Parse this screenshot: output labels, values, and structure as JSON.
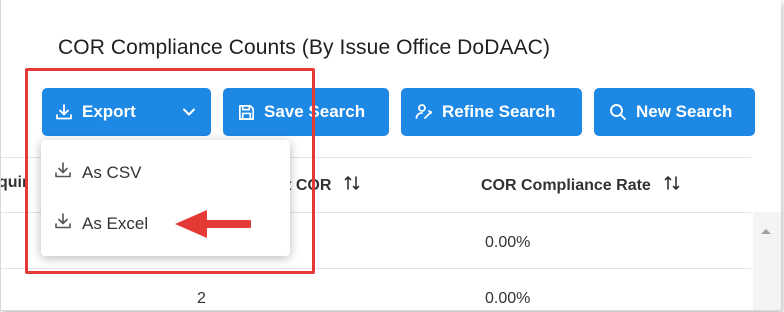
{
  "page": {
    "title": "COR Compliance Counts (By Issue Office DoDAAC)"
  },
  "toolbar": {
    "export_label": "Export",
    "save_label": "Save Search",
    "refine_label": "Refine Search",
    "new_label": "New Search"
  },
  "export_menu": {
    "items": [
      "As CSV",
      "As Excel"
    ]
  },
  "table": {
    "headers": [
      "quir",
      "ithout COR",
      "COR Compliance Rate"
    ],
    "rows": [
      {
        "without_cor": "",
        "rate": "0.00%"
      },
      {
        "without_cor": "2",
        "rate": "0.00%"
      }
    ]
  },
  "icons": {
    "download": "download-icon",
    "chevron": "chevron-down-icon",
    "save": "save-icon",
    "refine": "refine-search-icon",
    "search": "search-icon",
    "sort": "sort-icon"
  },
  "colors": {
    "primary": "#1e88e5",
    "highlight": "#e53935"
  }
}
